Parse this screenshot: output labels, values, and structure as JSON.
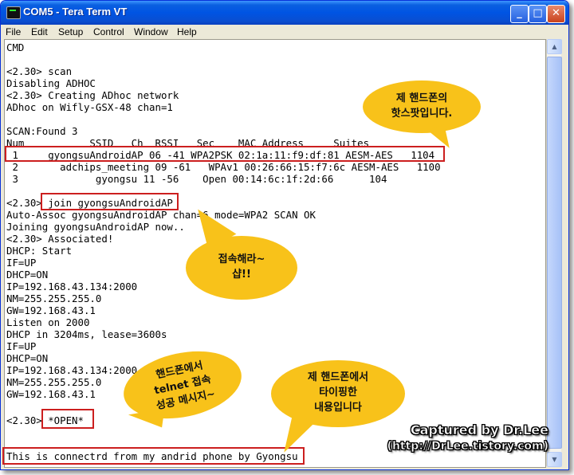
{
  "window": {
    "title": "COM5 - Tera Term VT",
    "buttons": {
      "minimize": "_",
      "maximize": "□",
      "close": "✕"
    }
  },
  "menu": [
    "File",
    "Edit",
    "Setup",
    "Control",
    "Window",
    "Help"
  ],
  "terminal": {
    "lines": [
      "CMD",
      "",
      "<2.30> scan",
      "Disabling ADHOC",
      "<2.30> Creating ADhoc network",
      "ADhoc on Wifly-GSX-48 chan=1",
      "",
      "SCAN:Found 3",
      "Num           SSID   Ch  RSSI   Sec    MAC Address     Suites",
      " 1     gyongsuAndroidAP 06 -41 WPA2PSK 02:1a:11:f9:df:81 AESM-AES   1104",
      " 2       adchips_meeting 09 -61   WPAv1 00:26:66:15:f7:6c AESM-AES   1100",
      " 3             gyongsu 11 -56    Open 00:14:6c:1f:2d:66      104",
      "",
      "<2.30> join gyongsuAndroidAP",
      "Auto-Assoc gyongsuAndroidAP chan=6 mode=WPA2 SCAN OK",
      "Joining gyongsuAndroidAP now..",
      "<2.30> Associated!",
      "DHCP: Start",
      "IF=UP",
      "DHCP=ON",
      "IP=192.168.43.134:2000",
      "NM=255.255.255.0",
      "GW=192.168.43.1",
      "Listen on 2000",
      "DHCP in 3204ms, lease=3600s",
      "IF=UP",
      "DHCP=ON",
      "IP=192.168.43.134:2000",
      "NM=255.255.255.0",
      "GW=192.168.43.1",
      "",
      "<2.30> *OPEN*",
      "",
      "",
      "This is connectrd from my andrid phone by Gyongsu"
    ]
  },
  "annotations": {
    "bubble_1": [
      "제 핸드폰의",
      "핫스팟입니다."
    ],
    "bubble_2": [
      "접속해라~",
      "샵!!"
    ],
    "bubble_3": [
      "핸드폰에서",
      "telnet 접속",
      "성공 메시지~"
    ],
    "bubble_4": [
      "제 핸드폰에서",
      "타이핑한",
      "내용입니다"
    ],
    "highlight_color": "#cc1f1f",
    "bubble_color": "#f8c21a"
  },
  "watermark": {
    "line1": "Captured by Dr.Lee",
    "line2": "(http://DrLee.tistory.com)"
  },
  "icons": {
    "app": "terminal-icon",
    "scroll_up": "arrow-up-icon",
    "scroll_down": "arrow-down-icon"
  }
}
